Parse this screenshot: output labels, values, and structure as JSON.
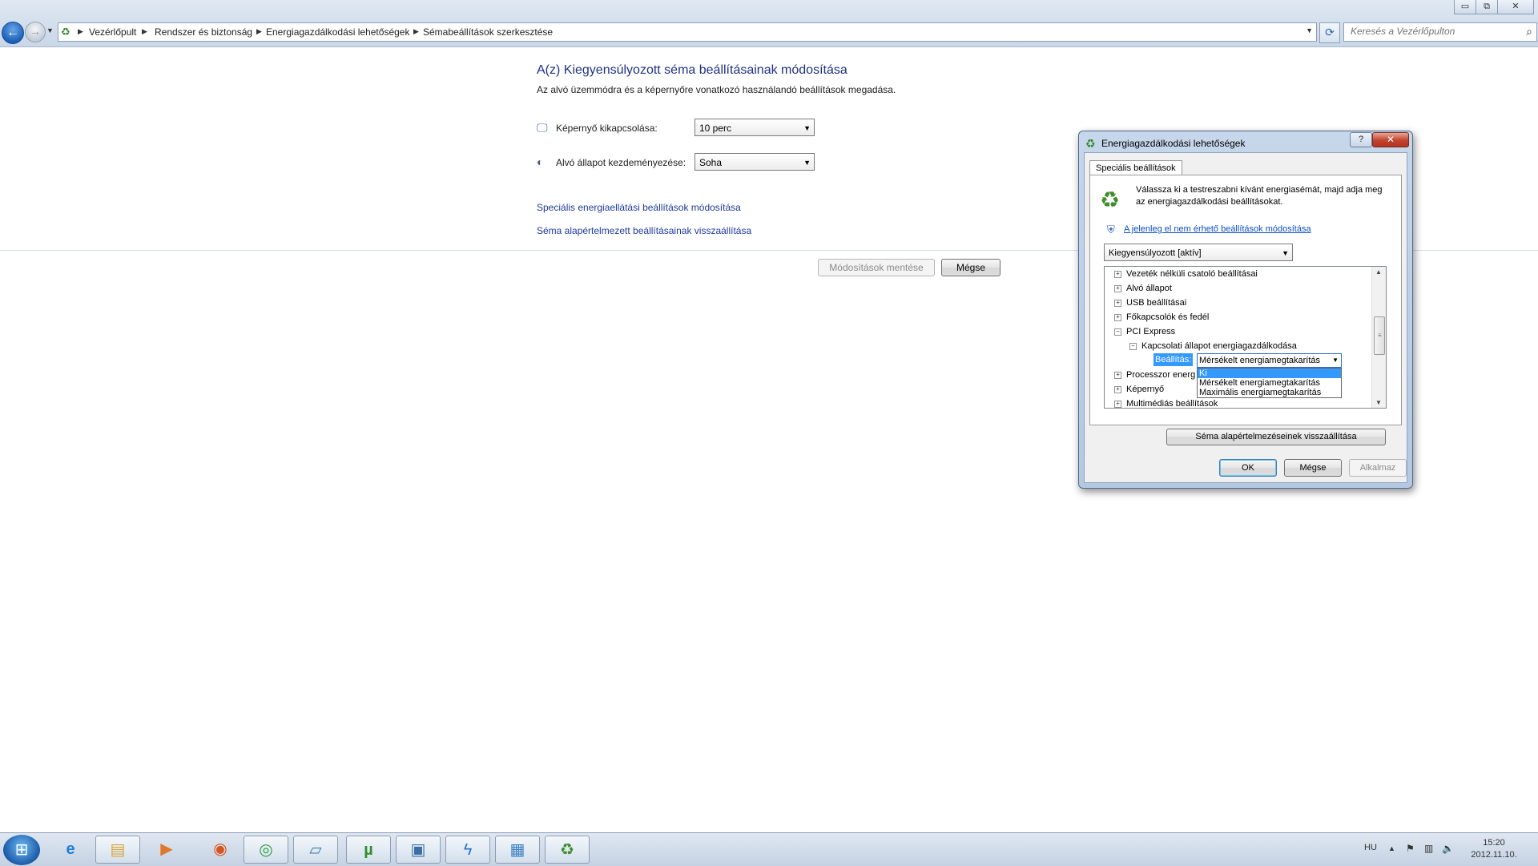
{
  "window": {
    "minimize_glyph": "▭",
    "maximize_glyph": "⧉",
    "close_glyph": "✕"
  },
  "nav": {
    "back_glyph": "←",
    "forward_glyph": "→",
    "recent_glyph": "▼",
    "address_icon": "power-options-icon",
    "breadcrumbs": [
      "Vezérlőpult",
      "Rendszer és biztonság",
      "Energiagazdálkodási lehetőségek",
      "Sémabeállítások szerkesztése"
    ],
    "separator_glyph": "▶",
    "dropdown_glyph": "▼",
    "refresh_glyph": "⟳",
    "search_placeholder": "Keresés a Vezérlőpulton",
    "search_glyph": "⌕"
  },
  "main": {
    "title": "A(z) Kiegyensúlyozott séma beállításainak módosítása",
    "subtitle": "Az alvó üzemmódra és a képernyőre vonatkozó használandó beállítások megadása.",
    "settings": [
      {
        "icon": "monitor-icon",
        "glyph": "🖵",
        "label": "Képernyő kikapcsolása:",
        "value": "10 perc"
      },
      {
        "icon": "moon-icon",
        "glyph": "◐",
        "label": "Alvó állapot kezdeményezése:",
        "value": "Soha"
      }
    ],
    "links": [
      "Speciális energiaellátási beállítások módosítása",
      "Séma alapértelmezett beállításainak visszaállítása"
    ],
    "save_button": "Módosítások mentése",
    "cancel_button": "Mégse"
  },
  "dialog": {
    "title": "Energiagazdálkodási lehetőségek",
    "help_glyph": "?",
    "close_glyph": "✕",
    "tab": "Speciális beállítások",
    "description": "Válassza ki a testreszabni kívánt energiasémát, majd adja meg az energiagazdálkodási beállításokat.",
    "unavailable_link": "A jelenleg el nem érhető beállítások módosítása",
    "plan_value": "Kiegyensúlyozott [aktív]",
    "tree": [
      {
        "label": "Vezeték nélküli csatoló beállításai",
        "toggle": "+"
      },
      {
        "label": "Alvó állapot",
        "toggle": "+"
      },
      {
        "label": "USB beállításai",
        "toggle": "+"
      },
      {
        "label": "Főkapcsolók és fedél",
        "toggle": "+"
      },
      {
        "label": "PCI Express",
        "toggle": "−"
      },
      {
        "label": "Kapcsolati állapot energiagazdálkodása",
        "toggle": "−"
      },
      {
        "label": "Processzor energ",
        "toggle": "+"
      },
      {
        "label": "Képernyő",
        "toggle": "+"
      },
      {
        "label": "Multimédiás beállítások",
        "toggle": "+"
      }
    ],
    "setting_label": "Beállítás:",
    "setting_value": "Mérsékelt energiamegtakarítás",
    "options": [
      "Ki",
      "Mérsékelt energiamegtakarítás",
      "Maximális energiamegtakarítás"
    ],
    "restore_button": "Séma alapértelmezéseinek visszaállítása",
    "ok_button": "OK",
    "cancel_button": "Mégse",
    "apply_button": "Alkalmaz"
  },
  "taskbar": {
    "start_glyph": "⊞",
    "items": [
      {
        "name": "internet-explorer-icon",
        "glyph": "e",
        "color": "#1e7fd6"
      },
      {
        "name": "file-explorer-icon",
        "glyph": "▤",
        "color": "#d9a53a"
      },
      {
        "name": "media-player-icon",
        "glyph": "▶",
        "color": "#e0772a"
      },
      {
        "name": "firefox-icon",
        "glyph": "◉",
        "color": "#d9531e"
      },
      {
        "name": "chrome-icon",
        "glyph": "◎",
        "color": "#2f9b45"
      },
      {
        "name": "notes-icon",
        "glyph": "▱",
        "color": "#3f7fa8"
      },
      {
        "name": "utorrent-icon",
        "glyph": "µ",
        "color": "#2f8f2f"
      },
      {
        "name": "image-viewer-icon",
        "glyph": "▣",
        "color": "#3b6ea5"
      },
      {
        "name": "flash-icon",
        "glyph": "ϟ",
        "color": "#2b6fd1"
      },
      {
        "name": "control-panel-icon",
        "glyph": "▦",
        "color": "#3b7fc4"
      },
      {
        "name": "power-options-icon",
        "glyph": "♻",
        "color": "#3f8d2c"
      }
    ],
    "language": "HU",
    "tray_up_glyph": "▲",
    "tray_flag_glyph": "⚑",
    "tray_network_glyph": "▥",
    "tray_volume_glyph": "🔈",
    "time": "15:20",
    "date": "2012.11.10."
  }
}
